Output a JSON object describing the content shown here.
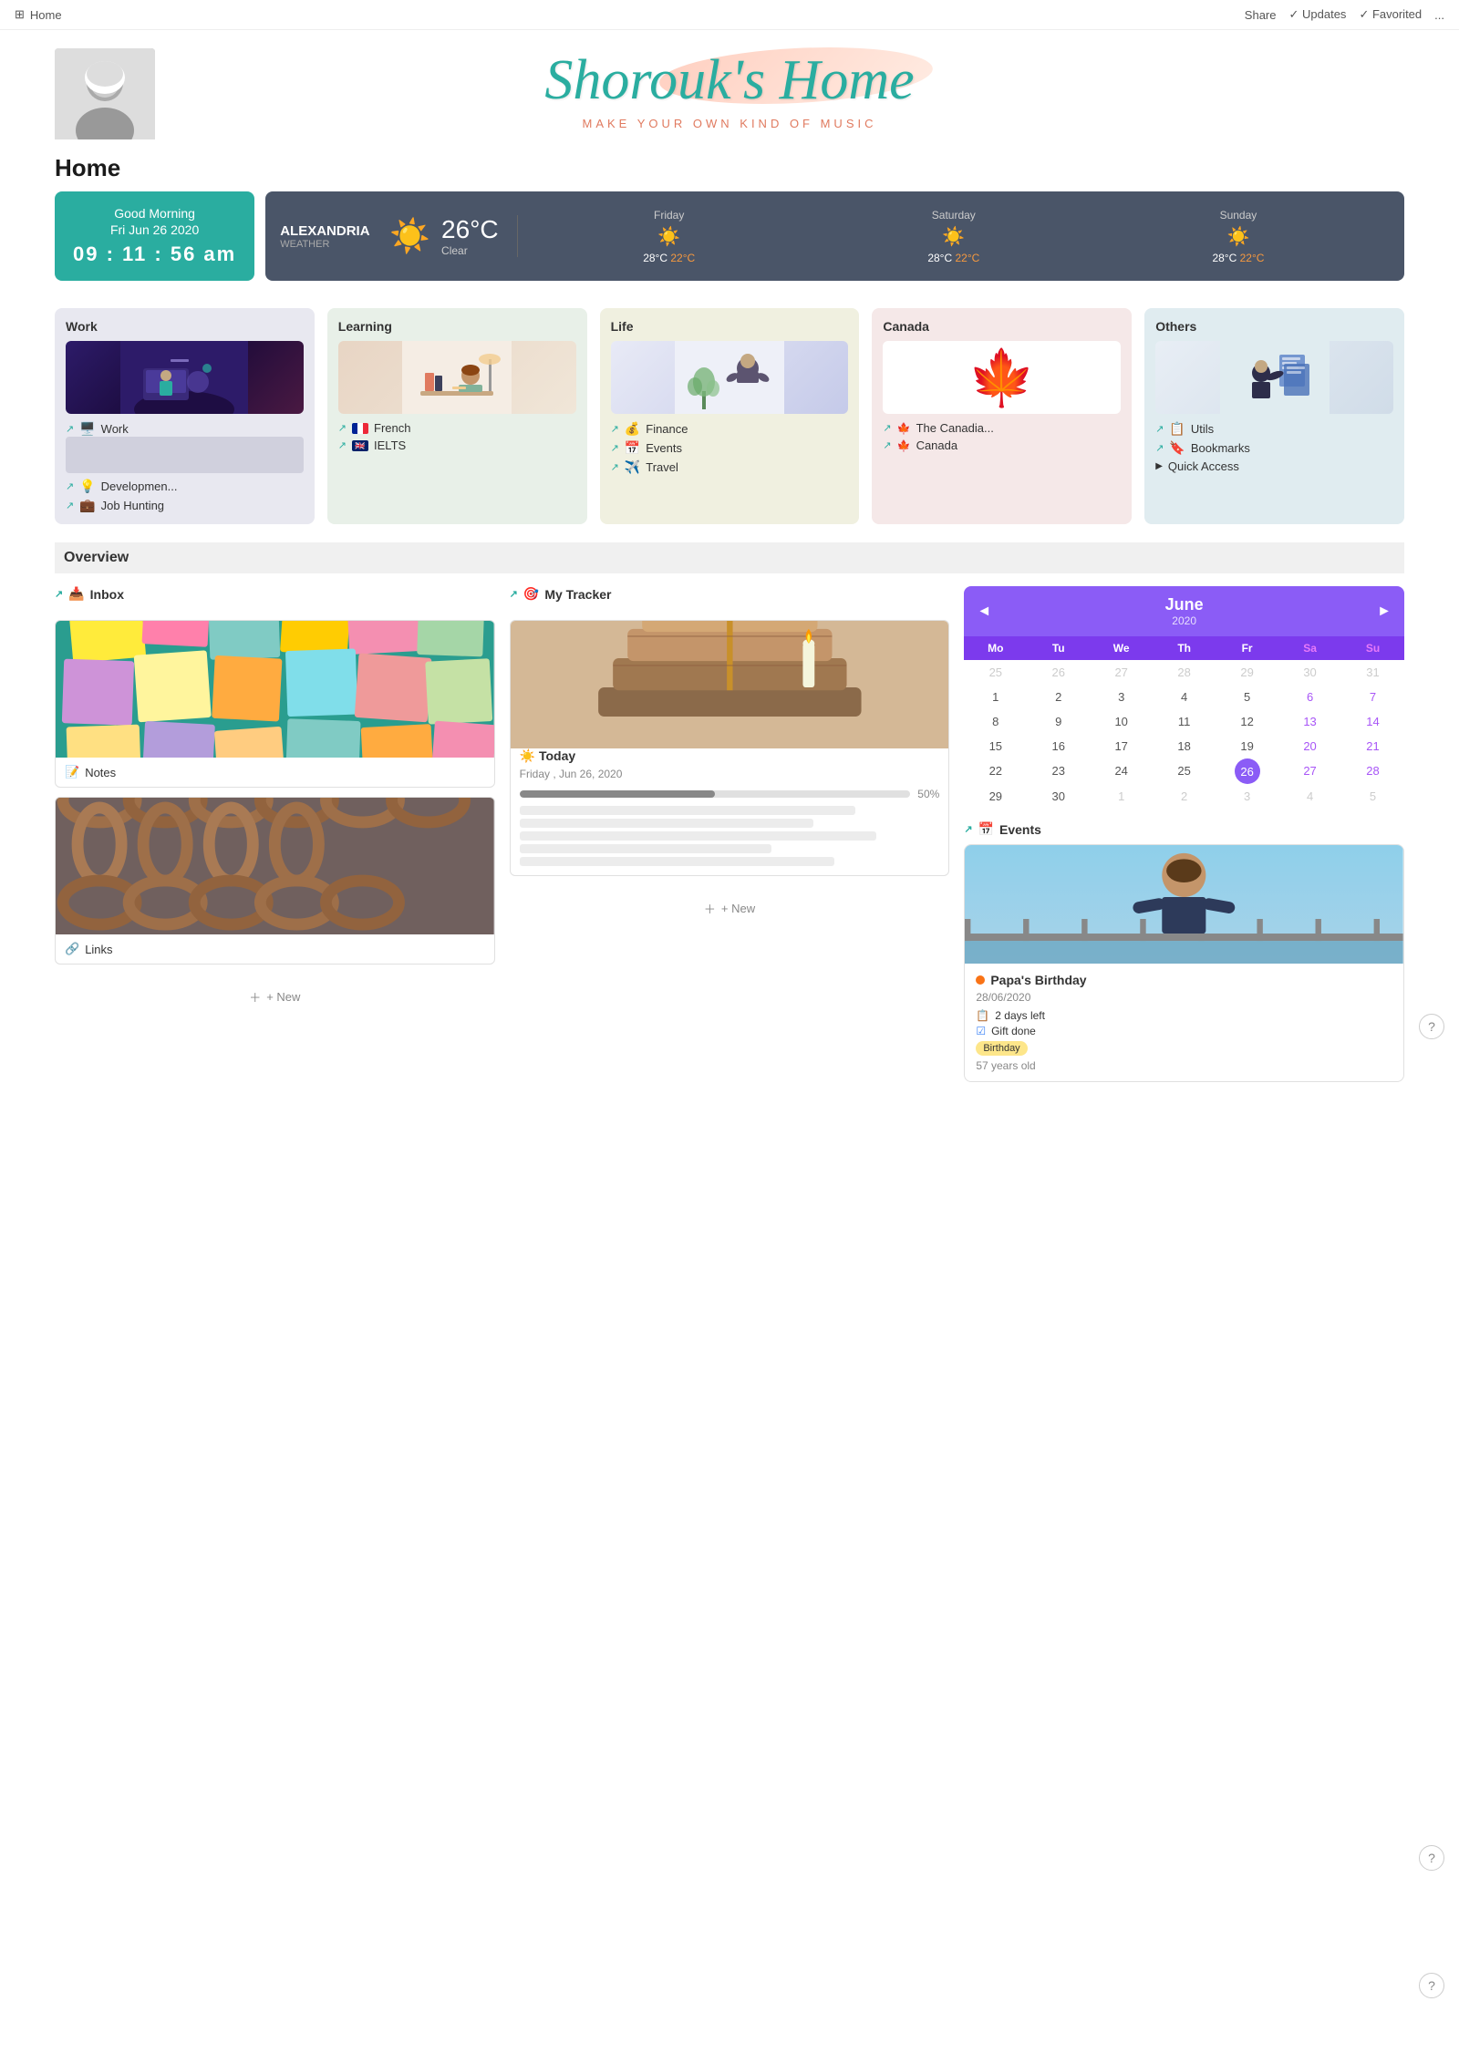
{
  "topnav": {
    "home": "Home",
    "share": "Share",
    "updates": "Updates",
    "favorited": "Favorited",
    "more": "..."
  },
  "header": {
    "title": "Shorouk's Home",
    "subtitle": "MAKE YOUR OWN KIND OF MUSIC"
  },
  "page": {
    "title": "Home"
  },
  "time_widget": {
    "greeting": "Good Morning",
    "date": "Fri Jun 26 2020",
    "time": "09 : 11 : 56 am"
  },
  "weather": {
    "city": "ALEXANDRIA",
    "label": "WEATHER",
    "temp": "26°C",
    "desc": "Clear",
    "icon": "☀️",
    "forecast": [
      {
        "day": "Friday",
        "icon": "☀️",
        "high": "28°C",
        "low": "22°C"
      },
      {
        "day": "Saturday",
        "icon": "☀️",
        "high": "28°C",
        "low": "22°C"
      },
      {
        "day": "Sunday",
        "icon": "☀️",
        "high": "28°C",
        "low": "22°C"
      }
    ]
  },
  "categories": [
    {
      "id": "work",
      "title": "Work",
      "links": [
        {
          "icon": "🖥️",
          "label": "Work"
        },
        {
          "icon": "💡",
          "label": "Developmen..."
        },
        {
          "icon": "💼",
          "label": "Job Hunting"
        }
      ]
    },
    {
      "id": "learning",
      "title": "Learning",
      "links": [
        {
          "flag": "fr",
          "label": "French"
        },
        {
          "flag": "uk",
          "label": "IELTS"
        }
      ]
    },
    {
      "id": "life",
      "title": "Life",
      "links": [
        {
          "icon": "💰",
          "label": "Finance"
        },
        {
          "icon": "📅",
          "label": "Events"
        },
        {
          "icon": "✈️",
          "label": "Travel"
        }
      ]
    },
    {
      "id": "canada",
      "title": "Canada",
      "links": [
        {
          "icon": "🍁",
          "label": "The Canadia..."
        },
        {
          "icon": "🍁",
          "label": "Canada"
        }
      ]
    },
    {
      "id": "others",
      "title": "Others",
      "links": [
        {
          "icon": "📋",
          "label": "Utils"
        },
        {
          "icon": "🔖",
          "label": "Bookmarks"
        }
      ],
      "extra": "Quick Access"
    }
  ],
  "overview": {
    "title": "Overview",
    "inbox": {
      "header": "Inbox",
      "icon": "📥",
      "items": [
        {
          "label": "Notes",
          "icon": "📝"
        },
        {
          "label": "Links",
          "icon": "🔗"
        }
      ],
      "new_label": "+ New"
    },
    "tracker": {
      "header": "My Tracker",
      "icon": "🎯",
      "today_label": "Today",
      "today_sun": "☀️",
      "date": "Friday , Jun 26, 2020",
      "progress": 50,
      "new_label": "+ New"
    },
    "calendar": {
      "month": "June",
      "year": "2020",
      "prev": "◄",
      "next": "►",
      "days_header": [
        "Mo",
        "Tu",
        "We",
        "Th",
        "Fr",
        "Sa",
        "Su"
      ],
      "weeks": [
        [
          "25",
          "26",
          "27",
          "28",
          "29",
          "30",
          "31"
        ],
        [
          "1",
          "2",
          "3",
          "4",
          "5",
          "6",
          "7"
        ],
        [
          "8",
          "9",
          "10",
          "11",
          "12",
          "13",
          "14"
        ],
        [
          "15",
          "16",
          "17",
          "18",
          "19",
          "20",
          "21"
        ],
        [
          "22",
          "23",
          "24",
          "25",
          "26",
          "27",
          "28"
        ],
        [
          "29",
          "30",
          "1",
          "2",
          "3",
          "4",
          "5"
        ]
      ]
    },
    "events": {
      "header": "Events",
      "icon": "📅",
      "event": {
        "name": "Papa's Birthday",
        "dot_color": "#f97316",
        "date": "28/06/2020",
        "days_left_icon": "📋",
        "days_left": "2 days left",
        "gift_icon": "☑️",
        "gift_label": "Gift done",
        "tag": "Birthday",
        "age": "57 years old"
      }
    }
  }
}
